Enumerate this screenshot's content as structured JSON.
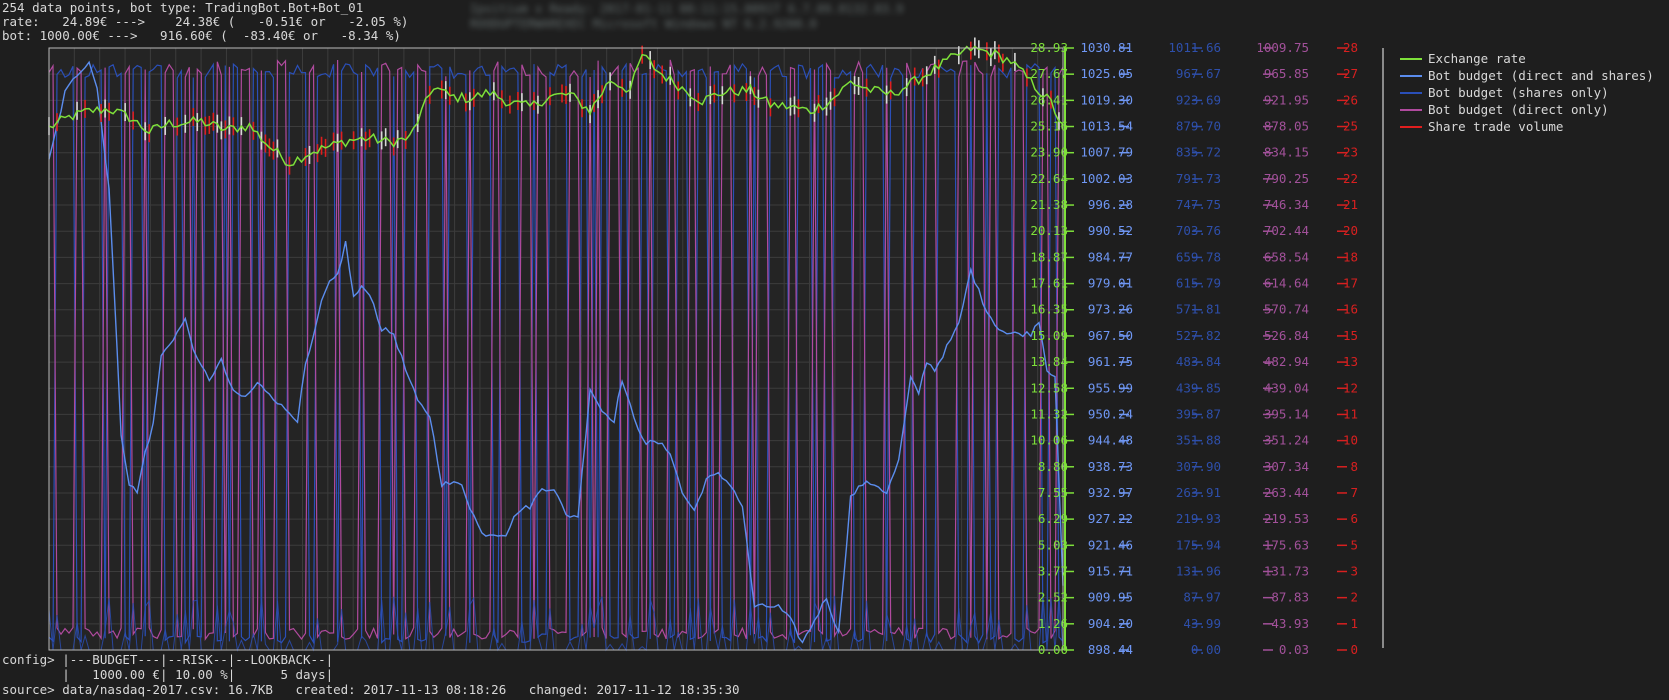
{
  "header": {
    "line1": "254 data points, bot type: TradingBot.Bot+Bot_01",
    "rate_label": "rate:",
    "rate_values": "   24.89€ --->    24.38€ (   -0.51€ or   -2.05 %)",
    "bot_label": "bot:",
    "bot_values": " 1000.00€ --->   916.60€ (  -83.40€ or   -8.34 %)",
    "blurred_1": "Ipsitium x Ready: 2017-01-11 08:11:15.0091T 6.7.09.0132.03.9 ",
    "blurred_2": "ROODUPTERWAREXEC Microsoft Windows NT 6.2.9200.0"
  },
  "axes": {
    "rate_ticks": [
      "28.93",
      "27.67",
      "26.41",
      "25.16",
      "23.90",
      "22.64",
      "21.38",
      "20.13",
      "18.87",
      "17.61",
      "16.35",
      "15.09",
      "13.84",
      "12.58",
      "11.32",
      "10.06",
      "8.80",
      "7.55",
      "6.29",
      "5.03",
      "3.77",
      "2.52",
      "1.26",
      "0.00"
    ],
    "budget_ticks": [
      "1030.81",
      "1025.05",
      "1019.30",
      "1013.54",
      "1007.79",
      "1002.03",
      "996.28",
      "990.52",
      "984.77",
      "979.01",
      "973.26",
      "967.50",
      "961.75",
      "955.99",
      "950.24",
      "944.48",
      "938.73",
      "932.97",
      "927.22",
      "921.46",
      "915.71",
      "909.95",
      "904.20",
      "898.44"
    ],
    "shares_ticks": [
      "1011.66",
      "967.67",
      "923.69",
      "879.70",
      "835.72",
      "791.73",
      "747.75",
      "703.76",
      "659.78",
      "615.79",
      "571.81",
      "527.82",
      "483.84",
      "439.85",
      "395.87",
      "351.88",
      "307.90",
      "263.91",
      "219.93",
      "175.94",
      "131.96",
      "87.97",
      "43.99",
      "0.00"
    ],
    "direct_ticks": [
      "1009.75",
      "965.85",
      "921.95",
      "878.05",
      "834.15",
      "790.25",
      "746.34",
      "702.44",
      "658.54",
      "614.64",
      "570.74",
      "526.84",
      "482.94",
      "439.04",
      "395.14",
      "351.24",
      "307.34",
      "263.44",
      "219.53",
      "175.63",
      "131.73",
      "87.83",
      "43.93",
      "0.03"
    ],
    "volume_ticks": [
      "28",
      "27",
      "26",
      "25",
      "23",
      "22",
      "21",
      "20",
      "18",
      "17",
      "16",
      "15",
      "13",
      "12",
      "11",
      "10",
      "8",
      "7",
      "6",
      "5",
      "3",
      "2",
      "1",
      "0"
    ]
  },
  "colors": {
    "background": "#1e1e1e",
    "grid": "#3c3c3c",
    "rate": "#7ee03a",
    "budget": "#5b8dee",
    "shares": "#2a4fb8",
    "direct": "#b04a9e",
    "volume": "#e01e1e",
    "frame": "#bbbbbb",
    "tick_rate": "#7ee03a",
    "tick_budget": "#6f97f4",
    "tick_shares": "#2e4faa",
    "tick_direct": "#a2519a",
    "tick_volume": "#d82020"
  },
  "legend": [
    {
      "label": "Exchange rate",
      "color": "#7ee03a"
    },
    {
      "label": "Bot budget (direct and shares)",
      "color": "#5b8dee"
    },
    {
      "label": "Bot budget (shares only)",
      "color": "#2a4fb8"
    },
    {
      "label": "Bot budget (direct only)",
      "color": "#b04a9e"
    },
    {
      "label": "Share trade volume",
      "color": "#e01e1e"
    }
  ],
  "footer": {
    "config_line1": "config> |---BUDGET---|--RISK--|--LOOKBACK--|",
    "config_line2": "        |   1000.00 €| 10.00 %|      5 days|",
    "source_line": "source> data/nasdaq-2017.csv: 16.7KB   created: 2017-11-13 08:18:26   changed: 2017-11-12 18:35:30"
  },
  "chart_data": {
    "type": "line",
    "title": "254 data points, bot type: TradingBot.Bot+Bot_01",
    "x_count": 254,
    "ylim_rate": [
      0,
      28.93
    ],
    "ylim_budget": [
      898.44,
      1030.81
    ],
    "ylim_shares": [
      0,
      1011.66
    ],
    "ylim_direct": [
      0.03,
      1009.75
    ],
    "ylim_volume": [
      0,
      28
    ],
    "grid": true,
    "legend_position": "right",
    "series": [
      {
        "name": "Exchange rate",
        "axis": "rate",
        "anchors": [
          [
            0,
            25.1
          ],
          [
            5,
            25.6
          ],
          [
            10,
            25.9
          ],
          [
            15,
            26.0
          ],
          [
            20,
            25.6
          ],
          [
            25,
            24.9
          ],
          [
            30,
            25.3
          ],
          [
            38,
            25.4
          ],
          [
            44,
            25.0
          ],
          [
            50,
            25.2
          ],
          [
            55,
            24.2
          ],
          [
            60,
            23.4
          ],
          [
            65,
            23.9
          ],
          [
            70,
            24.2
          ],
          [
            75,
            24.5
          ],
          [
            80,
            24.6
          ],
          [
            85,
            24.4
          ],
          [
            90,
            24.6
          ],
          [
            96,
            27.1
          ],
          [
            100,
            26.6
          ],
          [
            105,
            26.5
          ],
          [
            110,
            26.8
          ],
          [
            115,
            26.3
          ],
          [
            120,
            26.1
          ],
          [
            125,
            26.6
          ],
          [
            130,
            26.7
          ],
          [
            135,
            25.9
          ],
          [
            140,
            27.4
          ],
          [
            145,
            26.9
          ],
          [
            148,
            28.6
          ],
          [
            152,
            27.8
          ],
          [
            158,
            27.0
          ],
          [
            163,
            26.4
          ],
          [
            168,
            26.8
          ],
          [
            175,
            26.9
          ],
          [
            180,
            26.2
          ],
          [
            185,
            26.1
          ],
          [
            190,
            25.9
          ],
          [
            195,
            26.4
          ],
          [
            200,
            27.3
          ],
          [
            205,
            26.9
          ],
          [
            210,
            26.7
          ],
          [
            215,
            27.2
          ],
          [
            220,
            27.8
          ],
          [
            225,
            28.4
          ],
          [
            230,
            28.9
          ],
          [
            235,
            28.7
          ],
          [
            240,
            28.3
          ],
          [
            245,
            27.3
          ],
          [
            250,
            26.3
          ],
          [
            253,
            25.1
          ]
        ]
      },
      {
        "name": "Bot budget (direct and shares)",
        "axis": "budget",
        "anchors": [
          [
            0,
            1006
          ],
          [
            4,
            1021
          ],
          [
            7,
            1025
          ],
          [
            10,
            1028
          ],
          [
            12,
            1022
          ],
          [
            15,
            1000
          ],
          [
            18,
            946
          ],
          [
            20,
            935
          ],
          [
            22,
            933
          ],
          [
            24,
            942
          ],
          [
            26,
            948
          ],
          [
            28,
            963
          ],
          [
            31,
            967
          ],
          [
            34,
            971
          ],
          [
            37,
            962
          ],
          [
            40,
            958
          ],
          [
            43,
            962
          ],
          [
            46,
            955
          ],
          [
            49,
            954
          ],
          [
            52,
            957
          ],
          [
            55,
            955
          ],
          [
            58,
            952
          ],
          [
            61,
            950
          ],
          [
            62,
            949
          ],
          [
            64,
            961
          ],
          [
            66,
            967
          ],
          [
            68,
            975
          ],
          [
            70,
            979
          ],
          [
            72,
            981
          ],
          [
            74,
            988
          ],
          [
            76,
            976
          ],
          [
            78,
            978
          ],
          [
            80,
            977
          ],
          [
            83,
            969
          ],
          [
            86,
            968
          ],
          [
            89,
            960
          ],
          [
            92,
            953
          ],
          [
            95,
            950
          ],
          [
            98,
            935
          ],
          [
            100,
            935
          ],
          [
            103,
            935
          ],
          [
            105,
            930
          ],
          [
            108,
            924
          ],
          [
            111,
            924
          ],
          [
            114,
            924
          ],
          [
            117,
            929
          ],
          [
            120,
            930
          ],
          [
            123,
            934
          ],
          [
            126,
            934
          ],
          [
            129,
            928
          ],
          [
            132,
            928
          ],
          [
            135,
            956
          ],
          [
            138,
            951
          ],
          [
            141,
            949
          ],
          [
            143,
            958
          ],
          [
            146,
            949
          ],
          [
            149,
            944
          ],
          [
            152,
            944
          ],
          [
            155,
            942
          ],
          [
            158,
            933
          ],
          [
            161,
            929
          ],
          [
            164,
            936
          ],
          [
            167,
            937
          ],
          [
            170,
            935
          ],
          [
            173,
            930
          ],
          [
            176,
            908
          ],
          [
            179,
            908
          ],
          [
            182,
            908
          ],
          [
            185,
            905
          ],
          [
            188,
            900
          ],
          [
            191,
            905
          ],
          [
            194,
            910
          ],
          [
            197,
            902
          ],
          [
            200,
            932
          ],
          [
            203,
            935
          ],
          [
            206,
            935
          ],
          [
            209,
            933
          ],
          [
            212,
            940
          ],
          [
            215,
            958
          ],
          [
            217,
            955
          ],
          [
            219,
            962
          ],
          [
            221,
            960
          ],
          [
            224,
            965
          ],
          [
            227,
            970
          ],
          [
            230,
            982
          ],
          [
            233,
            975
          ],
          [
            236,
            970
          ],
          [
            239,
            968
          ],
          [
            242,
            968
          ],
          [
            245,
            968
          ],
          [
            247,
            971
          ],
          [
            249,
            960
          ],
          [
            251,
            959
          ],
          [
            253,
            912
          ]
        ]
      },
      {
        "name": "Bot budget (shares only)",
        "axis": "shares",
        "pattern": "alternates between near full budget and 0 on each buy/sell"
      },
      {
        "name": "Bot budget (direct only)",
        "axis": "direct",
        "pattern": "alternates between near full budget and 0 on each buy/sell"
      },
      {
        "name": "Share trade volume",
        "axis": "volume",
        "pattern": "small spikes at trade points"
      }
    ]
  }
}
